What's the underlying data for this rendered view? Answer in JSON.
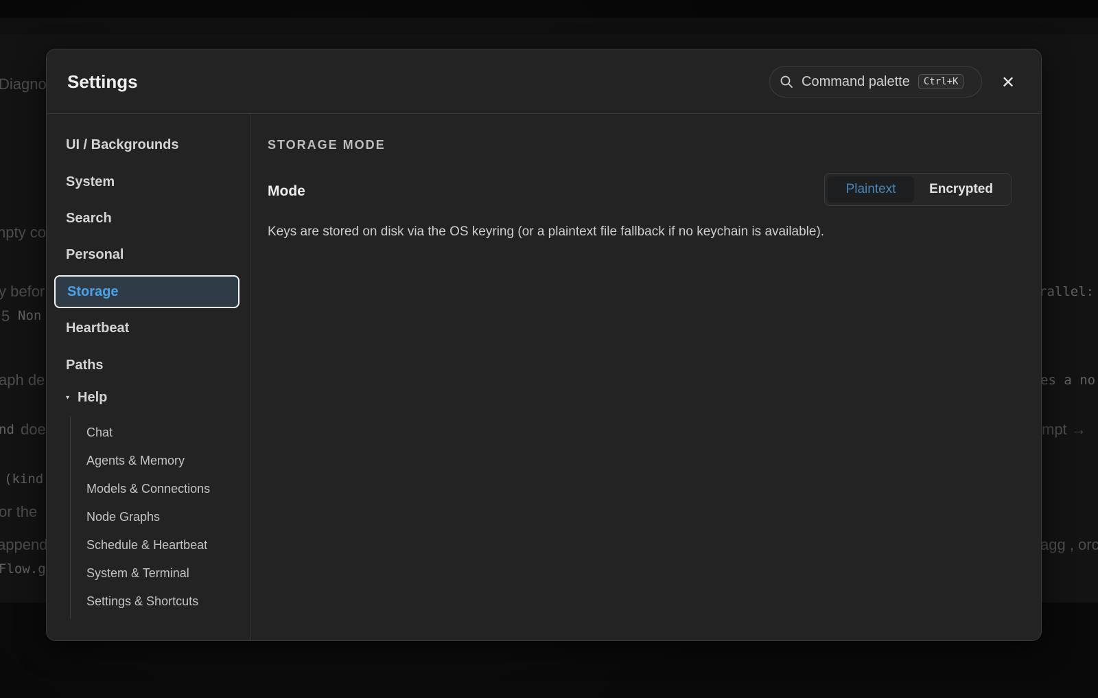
{
  "background": {
    "fragments": [
      "Diagno",
      "npty co",
      "y befor",
      "5",
      "Non",
      "aph de",
      "nd",
      "doe",
      "(kind",
      "or the",
      "append",
      "Flow.g",
      "rallel:",
      "es a no",
      "mpt →",
      "agg , orc"
    ]
  },
  "modal": {
    "title": "Settings",
    "command_palette": {
      "label": "Command palette",
      "shortcut": "Ctrl+K",
      "icon": "search-icon"
    },
    "close_icon": "close-icon",
    "close_glyph": "✕"
  },
  "sidebar": {
    "items": [
      {
        "label": "UI / Backgrounds"
      },
      {
        "label": "System"
      },
      {
        "label": "Search"
      },
      {
        "label": "Personal"
      },
      {
        "label": "Storage",
        "active": true
      },
      {
        "label": "Heartbeat"
      },
      {
        "label": "Paths"
      }
    ],
    "help": {
      "label": "Help",
      "caret": "▾",
      "children": [
        {
          "label": "Chat"
        },
        {
          "label": "Agents & Memory"
        },
        {
          "label": "Models & Connections"
        },
        {
          "label": "Node Graphs"
        },
        {
          "label": "Schedule & Heartbeat"
        },
        {
          "label": "System & Terminal"
        },
        {
          "label": "Settings & Shortcuts"
        }
      ]
    }
  },
  "content": {
    "section_title": "STORAGE MODE",
    "mode_label": "Mode",
    "mode_options": [
      {
        "label": "Plaintext",
        "selected": true
      },
      {
        "label": "Encrypted",
        "selected": false
      }
    ],
    "description": "Keys are stored on disk via the OS keyring (or a plaintext file fallback if no keychain is available)."
  },
  "colors": {
    "accent": "#4aa3e6",
    "selected_segment": "#4a85b6",
    "modal_bg": "#232323"
  }
}
